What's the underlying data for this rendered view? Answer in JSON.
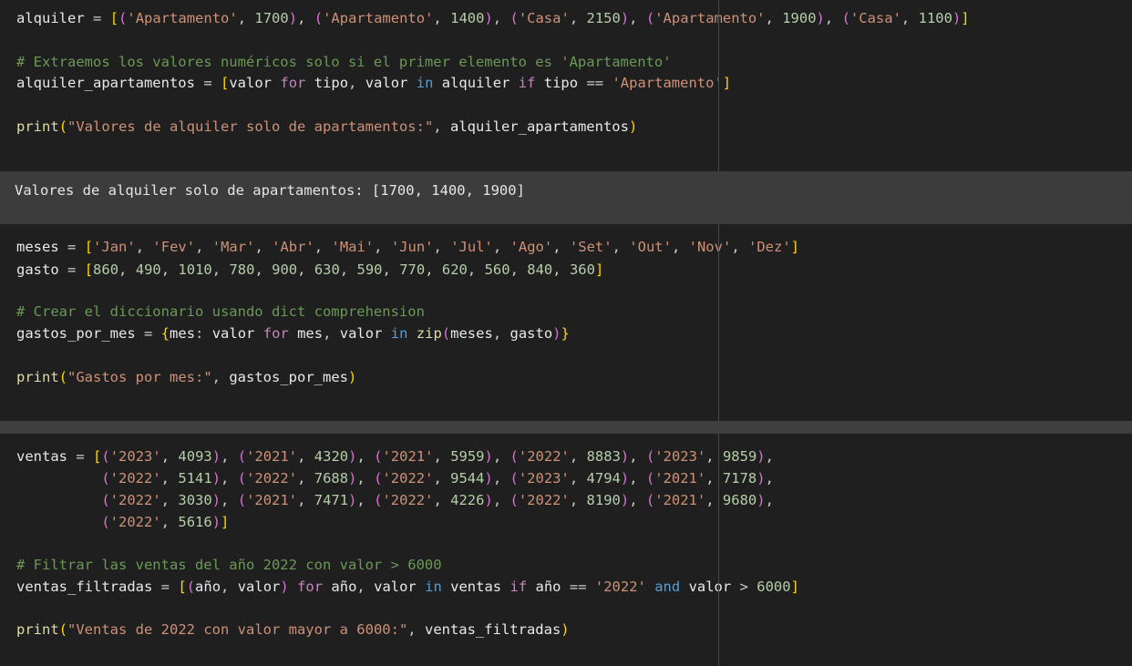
{
  "cell1": {
    "lines": [
      "alquiler = [('Apartamento', 1700), ('Apartamento', 1400), ('Casa', 2150), ('Apartamento', 1900), ('Casa', 1100)]",
      "",
      "# Extraemos los valores numéricos solo si el primer elemento es 'Apartamento'",
      "alquiler_apartamentos = [valor for tipo, valor in alquiler if tipo == 'Apartamento']",
      "",
      "print(\"Valores de alquiler solo de apartamentos:\", alquiler_apartamentos)"
    ]
  },
  "output1": {
    "text": "Valores de alquiler solo de apartamentos: [1700, 1400, 1900]"
  },
  "cell2": {
    "lines": [
      "meses = ['Jan', 'Fev', 'Mar', 'Abr', 'Mai', 'Jun', 'Jul', 'Ago', 'Set', 'Out', 'Nov', 'Dez']",
      "gasto = [860, 490, 1010, 780, 900, 630, 590, 770, 620, 560, 840, 360]",
      "",
      "# Crear el diccionario usando dict comprehension",
      "gastos_por_mes = {mes: valor for mes, valor in zip(meses, gasto)}",
      "",
      "print(\"Gastos por mes:\", gastos_por_mes)"
    ]
  },
  "cell3": {
    "lines": [
      "ventas = [('2023', 4093), ('2021', 4320), ('2021', 5959), ('2022', 8883), ('2023', 9859),",
      "          ('2022', 5141), ('2022', 7688), ('2022', 9544), ('2023', 4794), ('2021', 7178),",
      "          ('2022', 3030), ('2021', 7471), ('2022', 4226), ('2022', 8190), ('2021', 9680),",
      "          ('2022', 5616)]",
      "",
      "# Filtrar las ventas del año 2022 con valor > 6000",
      "ventas_filtradas = [(año, valor) for año, valor in ventas if año == '2022' and valor > 6000]",
      "",
      "print(\"Ventas de 2022 con valor mayor a 6000:\", ventas_filtradas)"
    ]
  }
}
